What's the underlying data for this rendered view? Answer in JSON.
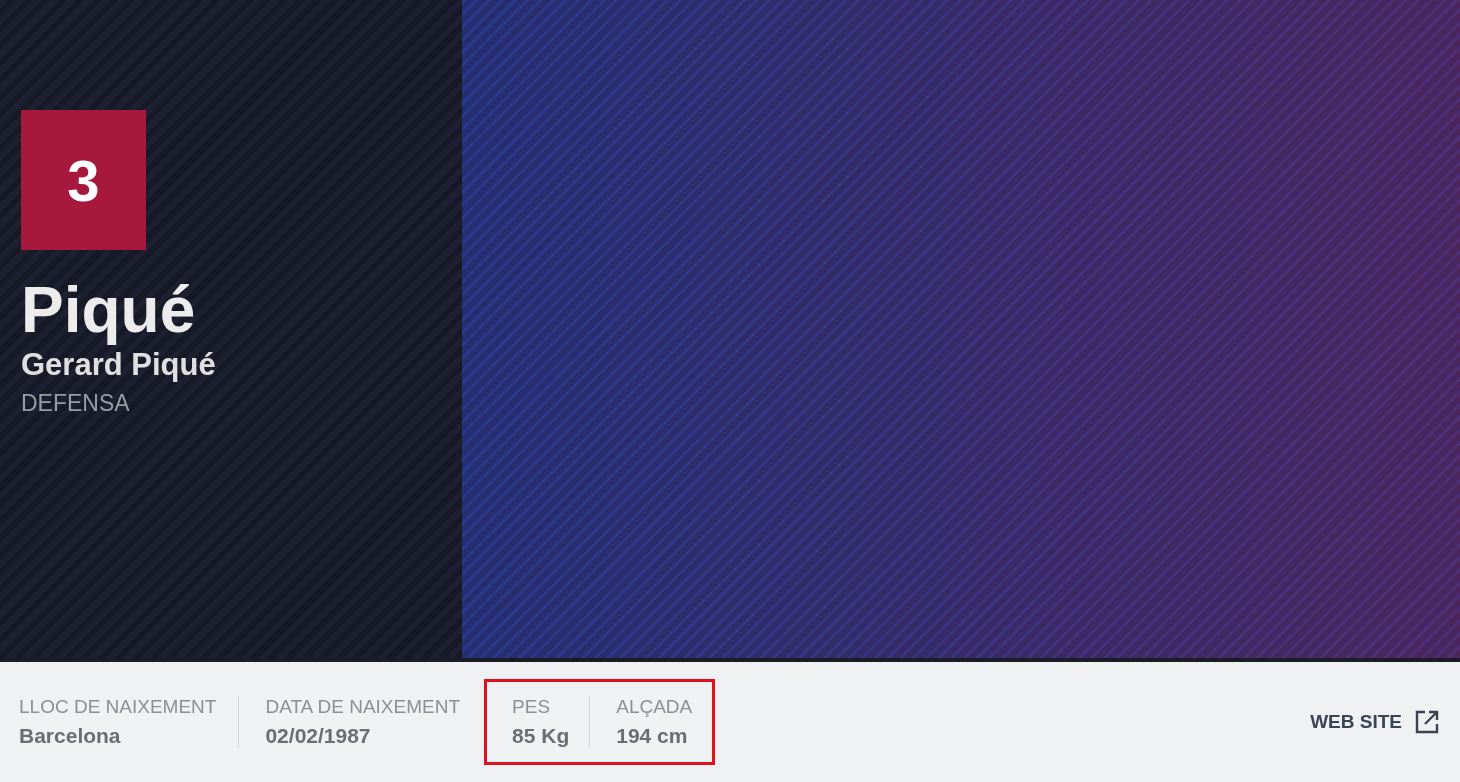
{
  "player": {
    "number": "3",
    "short_name": "Piqué",
    "full_name": "Gerard Piqué",
    "position": "DEFENSA"
  },
  "stats": [
    {
      "label": "LLOC DE NAIXEMENT",
      "value": "Barcelona",
      "highlighted": false
    },
    {
      "label": "DATA DE NAIXEMENT",
      "value": "02/02/1987",
      "highlighted": false
    },
    {
      "label": "PES",
      "value": "85 Kg",
      "highlighted": true
    },
    {
      "label": "ALÇADA",
      "value": "194 cm",
      "highlighted": true
    }
  ],
  "link": {
    "label": "WEB SITE"
  }
}
